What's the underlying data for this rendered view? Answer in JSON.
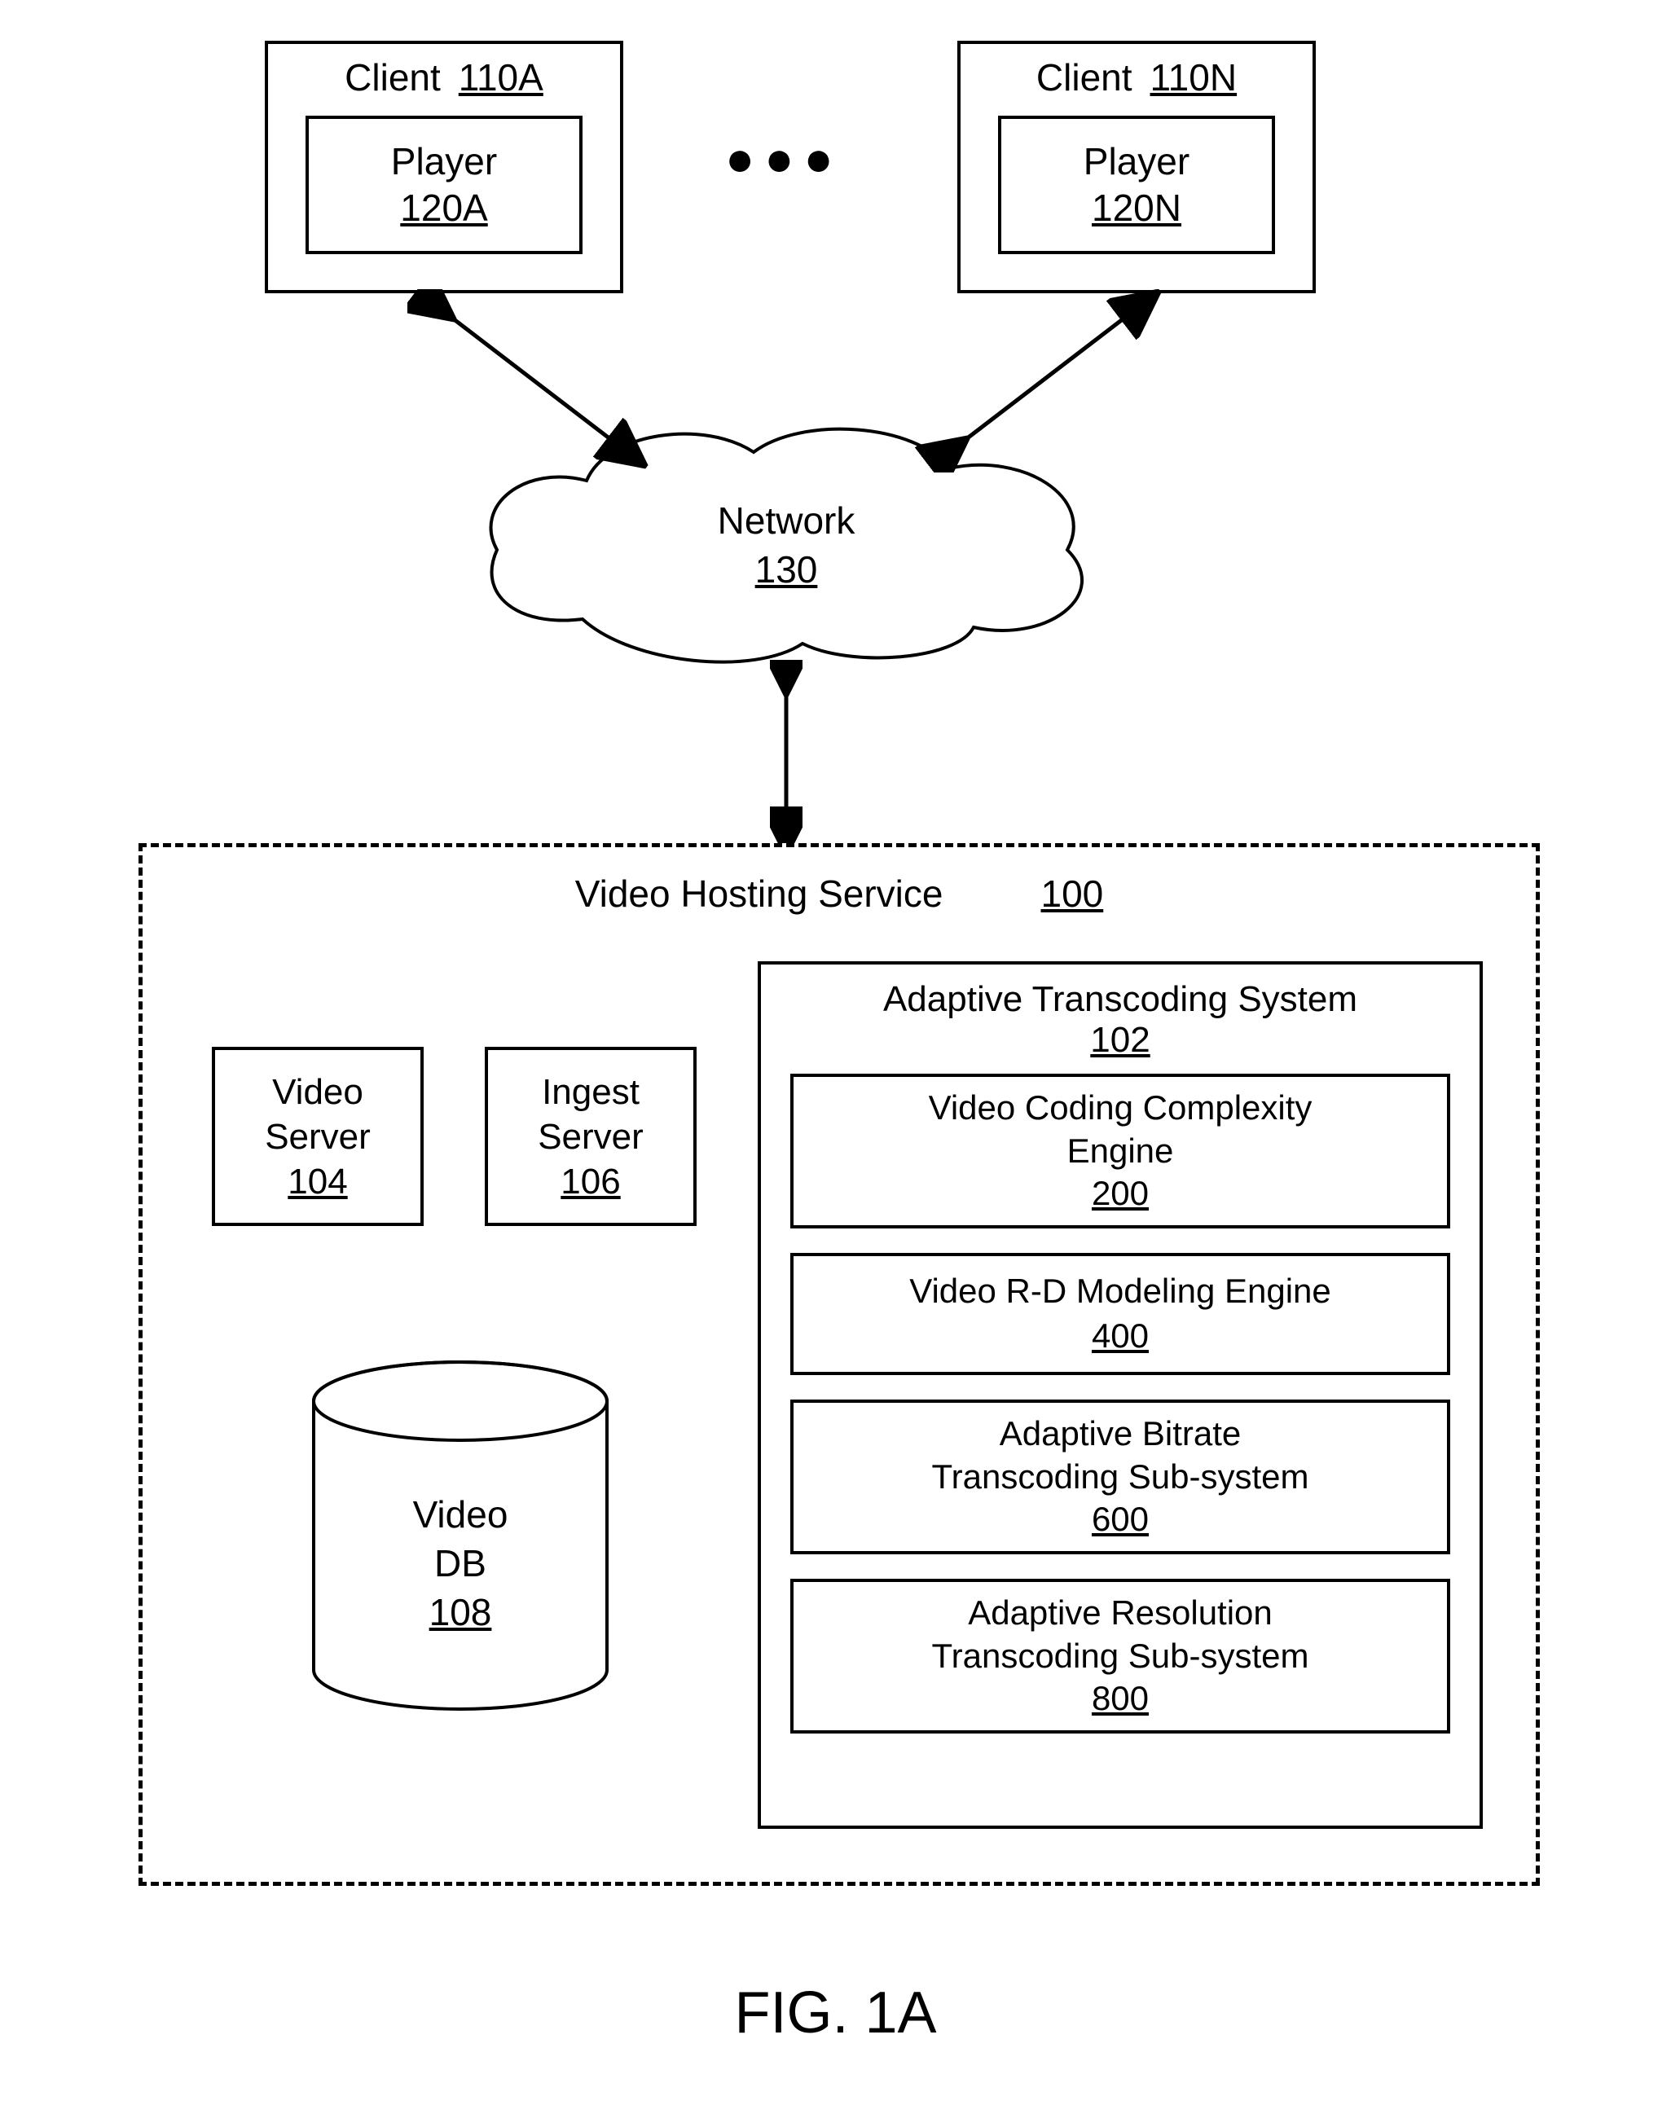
{
  "clientA": {
    "label": "Client",
    "ref": "110A",
    "player_label": "Player",
    "player_ref": "120A"
  },
  "clientN": {
    "label": "Client",
    "ref": "110N",
    "player_label": "Player",
    "player_ref": "120N"
  },
  "ellipsis": "●●●",
  "network": {
    "label": "Network",
    "ref": "130"
  },
  "vhs": {
    "label": "Video Hosting Service",
    "ref": "100"
  },
  "videoServer": {
    "line1": "Video",
    "line2": "Server",
    "ref": "104"
  },
  "ingestServer": {
    "line1": "Ingest",
    "line2": "Server",
    "ref": "106"
  },
  "videoDB": {
    "line1": "Video",
    "line2": "DB",
    "ref": "108"
  },
  "ats": {
    "label": "Adaptive Transcoding System",
    "ref": "102"
  },
  "vcc": {
    "line1": "Video Coding Complexity",
    "line2": "Engine",
    "ref": "200"
  },
  "rd": {
    "line1": "Video R-D Modeling Engine",
    "ref": "400"
  },
  "abt": {
    "line1": "Adaptive Bitrate",
    "line2": "Transcoding Sub-system",
    "ref": "600"
  },
  "art": {
    "line1": "Adaptive Resolution",
    "line2": "Transcoding Sub-system",
    "ref": "800"
  },
  "figure": "FIG. 1A"
}
